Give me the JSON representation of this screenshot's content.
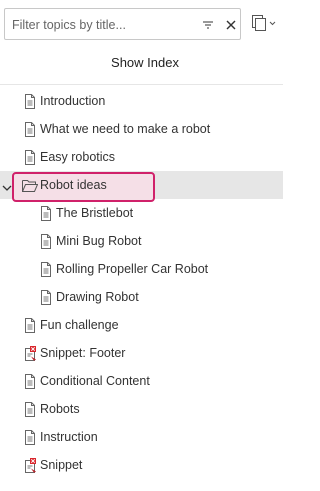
{
  "search": {
    "placeholder": "Filter topics by title..."
  },
  "header": {
    "show_index_label": "Show Index"
  },
  "tree": {
    "items": [
      {
        "label": "Introduction"
      },
      {
        "label": "What we need to make a robot"
      },
      {
        "label": "Easy robotics"
      },
      {
        "label": "Robot ideas"
      },
      {
        "label": "The Bristlebot"
      },
      {
        "label": "Mini Bug Robot"
      },
      {
        "label": "Rolling Propeller Car Robot"
      },
      {
        "label": "Drawing Robot"
      },
      {
        "label": "Fun challenge"
      },
      {
        "label": "Snippet: Footer"
      },
      {
        "label": "Conditional Content"
      },
      {
        "label": "Robots"
      },
      {
        "label": "Instruction"
      },
      {
        "label": "Snippet"
      }
    ]
  },
  "icons": {
    "filter": "filter-icon",
    "clear": "close-icon",
    "view": "copy-view-icon",
    "topic": "document-icon",
    "snippet": "snippet-error-icon",
    "folder": "folder-open-icon",
    "chevron": "chevron-down-icon"
  },
  "colors": {
    "selection_border": "#d0216a",
    "selection_fill": "#f5dfe7",
    "row_selected_bg": "#e6e6e6"
  }
}
